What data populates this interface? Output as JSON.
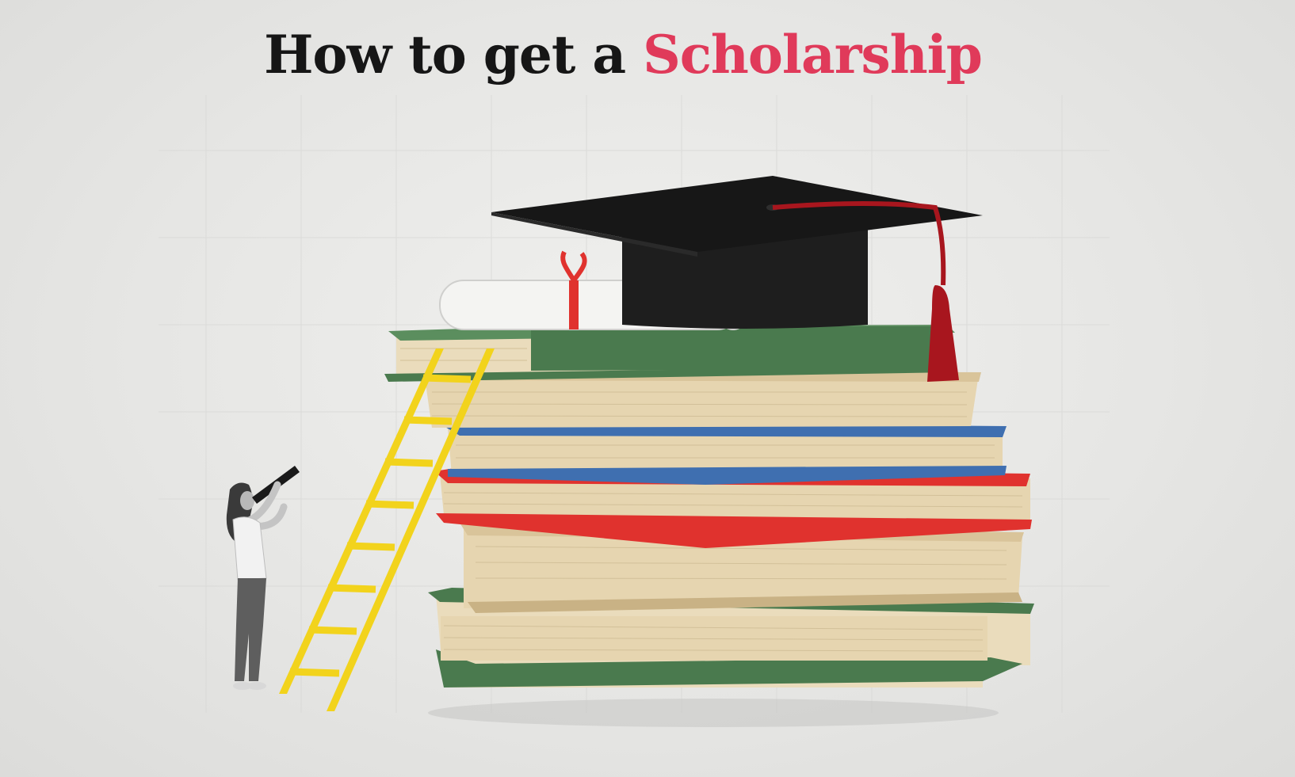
{
  "headline": {
    "prefix": "How to get a",
    "highlight": "Scholarship"
  },
  "colors": {
    "headline_text": "#161616",
    "highlight_text": "#e03a5a",
    "background": "#e8e8e6",
    "ladder": "#f2d31c",
    "book_green": "#4a7a4e",
    "book_blue": "#3f6fb0",
    "book_red": "#e0322e",
    "book_pages": "#eadcbc",
    "cap": "#171717",
    "tassel": "#a8161e",
    "diploma": "#f4f4f2",
    "ribbon": "#e0322e"
  },
  "illustration": {
    "scene": "scholarship-illustration",
    "objects": [
      "graduation-cap-icon",
      "diploma-scroll-icon",
      "book-stack-icon",
      "ladder-icon",
      "person-with-telescope-icon"
    ]
  }
}
